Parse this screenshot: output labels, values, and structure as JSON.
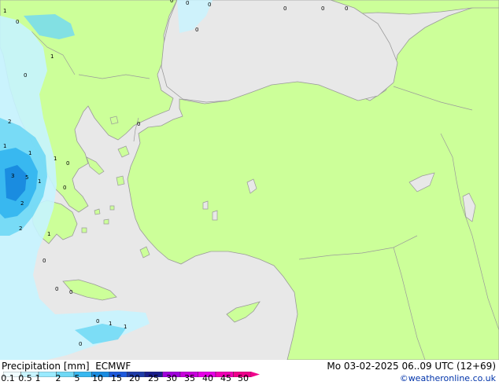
{
  "legend": {
    "title": "Precipitation [mm]  ECMWF",
    "valid_time": "Mo 03-02-2025 06..09 UTC (12+69)",
    "credit": "©weatheronline.co.uk",
    "ticks": [
      "0.1",
      "0.5",
      "1",
      "2",
      "5",
      "10",
      "15",
      "20",
      "25",
      "30",
      "35",
      "40",
      "45",
      "50"
    ],
    "colors": [
      "#f0fcff",
      "#c7f4ff",
      "#9aeaff",
      "#6fd8f5",
      "#38b8f0",
      "#1a8ce0",
      "#1e5adc",
      "#1e3ca8",
      "#1a1e8c",
      "#a000dc",
      "#c800dc",
      "#e600e6",
      "#f000b4",
      "#f0008c"
    ]
  },
  "map": {
    "colors": {
      "sea": "#e8e8e8",
      "land": "#ccff99",
      "border": "#9a9a9a",
      "precip_light": "#c7f4ff",
      "precip_mid": "#6fd8f5",
      "precip_heavy": "#38b8f0",
      "precip_core": "#1a8ce0"
    },
    "point_values": [
      "1",
      "0",
      "0",
      "1",
      "0",
      "0",
      "0",
      "0",
      "0",
      "0",
      "0",
      "0",
      "2",
      "3",
      "1",
      "1",
      "1",
      "0",
      "5",
      "1",
      "2",
      "0",
      "2",
      "1",
      "0",
      "0",
      "0",
      "0",
      "1",
      "0",
      "1"
    ]
  }
}
